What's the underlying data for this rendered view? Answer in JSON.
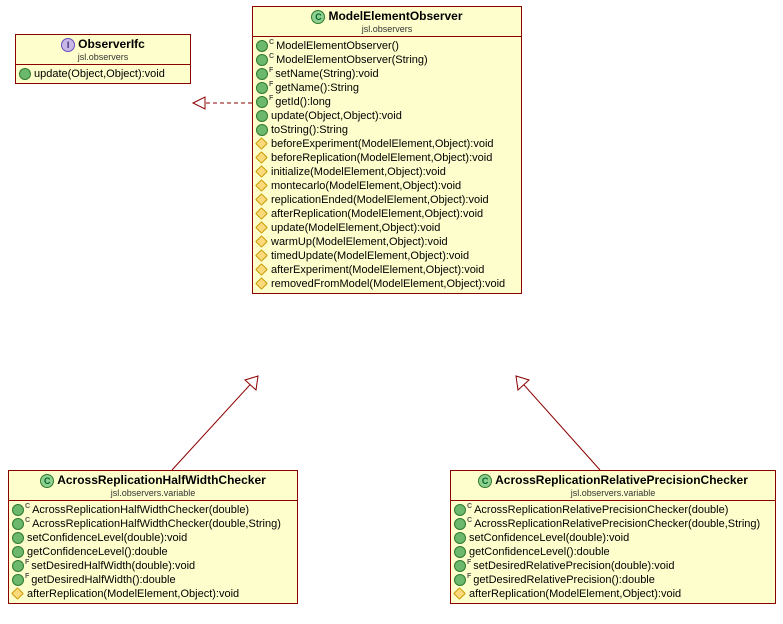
{
  "interface": {
    "name": "ObserverIfc",
    "pkg": "jsl.observers",
    "members": [
      {
        "vis": "public",
        "sig": "update(Object,Object):void"
      }
    ]
  },
  "base": {
    "name": "ModelElementObserver",
    "pkg": "jsl.observers",
    "members": [
      {
        "vis": "public",
        "tag": "C",
        "sig": "ModelElementObserver()"
      },
      {
        "vis": "public",
        "tag": "C",
        "sig": "ModelElementObserver(String)"
      },
      {
        "vis": "public",
        "tag": "F",
        "sig": "setName(String):void"
      },
      {
        "vis": "public",
        "tag": "F",
        "sig": "getName():String"
      },
      {
        "vis": "public",
        "tag": "F",
        "sig": "getId():long"
      },
      {
        "vis": "public",
        "sig": "update(Object,Object):void"
      },
      {
        "vis": "public",
        "sig": "toString():String"
      },
      {
        "vis": "protected",
        "sig": "beforeExperiment(ModelElement,Object):void"
      },
      {
        "vis": "protected",
        "sig": "beforeReplication(ModelElement,Object):void"
      },
      {
        "vis": "protected",
        "sig": "initialize(ModelElement,Object):void"
      },
      {
        "vis": "protected",
        "sig": "montecarlo(ModelElement,Object):void"
      },
      {
        "vis": "protected",
        "sig": "replicationEnded(ModelElement,Object):void"
      },
      {
        "vis": "protected",
        "sig": "afterReplication(ModelElement,Object):void"
      },
      {
        "vis": "protected",
        "sig": "update(ModelElement,Object):void"
      },
      {
        "vis": "protected",
        "sig": "warmUp(ModelElement,Object):void"
      },
      {
        "vis": "protected",
        "sig": "timedUpdate(ModelElement,Object):void"
      },
      {
        "vis": "protected",
        "sig": "afterExperiment(ModelElement,Object):void"
      },
      {
        "vis": "protected",
        "sig": "removedFromModel(ModelElement,Object):void"
      }
    ]
  },
  "left": {
    "name": "AcrossReplicationHalfWidthChecker",
    "pkg": "jsl.observers.variable",
    "members": [
      {
        "vis": "public",
        "tag": "C",
        "sig": "AcrossReplicationHalfWidthChecker(double)"
      },
      {
        "vis": "public",
        "tag": "C",
        "sig": "AcrossReplicationHalfWidthChecker(double,String)"
      },
      {
        "vis": "public",
        "sig": "setConfidenceLevel(double):void"
      },
      {
        "vis": "public",
        "sig": "getConfidenceLevel():double"
      },
      {
        "vis": "public",
        "tag": "F",
        "sig": "setDesiredHalfWidth(double):void"
      },
      {
        "vis": "public",
        "tag": "F",
        "sig": "getDesiredHalfWidth():double"
      },
      {
        "vis": "protected",
        "sig": "afterReplication(ModelElement,Object):void"
      }
    ]
  },
  "right": {
    "name": "AcrossReplicationRelativePrecisionChecker",
    "pkg": "jsl.observers.variable",
    "members": [
      {
        "vis": "public",
        "tag": "C",
        "sig": "AcrossReplicationRelativePrecisionChecker(double)"
      },
      {
        "vis": "public",
        "tag": "C",
        "sig": "AcrossReplicationRelativePrecisionChecker(double,String)"
      },
      {
        "vis": "public",
        "sig": "setConfidenceLevel(double):void"
      },
      {
        "vis": "public",
        "sig": "getConfidenceLevel():double"
      },
      {
        "vis": "public",
        "tag": "F",
        "sig": "setDesiredRelativePrecision(double):void"
      },
      {
        "vis": "public",
        "tag": "F",
        "sig": "getDesiredRelativePrecision():double"
      },
      {
        "vis": "protected",
        "sig": "afterReplication(ModelElement,Object):void"
      }
    ]
  }
}
